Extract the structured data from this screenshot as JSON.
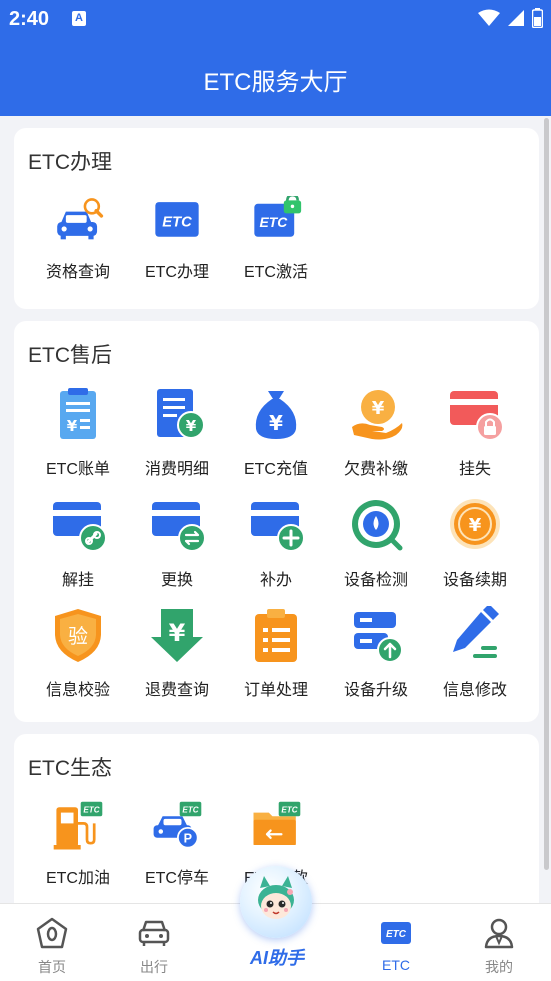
{
  "status": {
    "time": "2:40",
    "notification_glyph": "A"
  },
  "header": {
    "title": "ETC服务大厅"
  },
  "colors": {
    "primary": "#2f6ce8",
    "orange": "#f7941d",
    "green": "#31a46c"
  },
  "sections": [
    {
      "title": "ETC办理",
      "items": [
        {
          "label": "资格查询",
          "icon": "car-search-icon"
        },
        {
          "label": "ETC办理",
          "icon": "etc-card-icon"
        },
        {
          "label": "ETC激活",
          "icon": "etc-unlock-icon"
        }
      ]
    },
    {
      "title": "ETC售后",
      "items": [
        {
          "label": "ETC账单",
          "icon": "bill-icon"
        },
        {
          "label": "消费明细",
          "icon": "consumption-detail-icon"
        },
        {
          "label": "ETC充值",
          "icon": "money-bag-icon"
        },
        {
          "label": "欠费补缴",
          "icon": "coin-hand-icon"
        },
        {
          "label": "挂失",
          "icon": "card-lock-icon"
        },
        {
          "label": "解挂",
          "icon": "card-unlink-icon"
        },
        {
          "label": "更换",
          "icon": "card-swap-icon"
        },
        {
          "label": "补办",
          "icon": "card-add-icon"
        },
        {
          "label": "设备检测",
          "icon": "device-check-icon"
        },
        {
          "label": "设备续期",
          "icon": "device-renew-icon"
        },
        {
          "label": "信息校验",
          "icon": "shield-verify-icon"
        },
        {
          "label": "退费查询",
          "icon": "refund-icon"
        },
        {
          "label": "订单处理",
          "icon": "clipboard-icon"
        },
        {
          "label": "设备升级",
          "icon": "device-upgrade-icon"
        },
        {
          "label": "信息修改",
          "icon": "edit-pen-icon"
        }
      ],
      "verify_glyph": "验",
      "yuan_glyph": "¥"
    },
    {
      "title": "ETC生态",
      "items": [
        {
          "label": "ETC加油",
          "icon": "fuel-icon"
        },
        {
          "label": "ETC停车",
          "icon": "parking-icon"
        },
        {
          "label": "ETC缴款",
          "icon": "payment-icon"
        }
      ]
    }
  ],
  "tabbar": {
    "items": [
      {
        "label": "首页",
        "icon": "home-icon"
      },
      {
        "label": "出行",
        "icon": "car-icon"
      },
      {
        "label": "AI助手",
        "icon": "ai-assistant-icon"
      },
      {
        "label": "ETC",
        "icon": "etc-tab-icon",
        "active": true
      },
      {
        "label": "我的",
        "icon": "user-icon"
      }
    ]
  }
}
